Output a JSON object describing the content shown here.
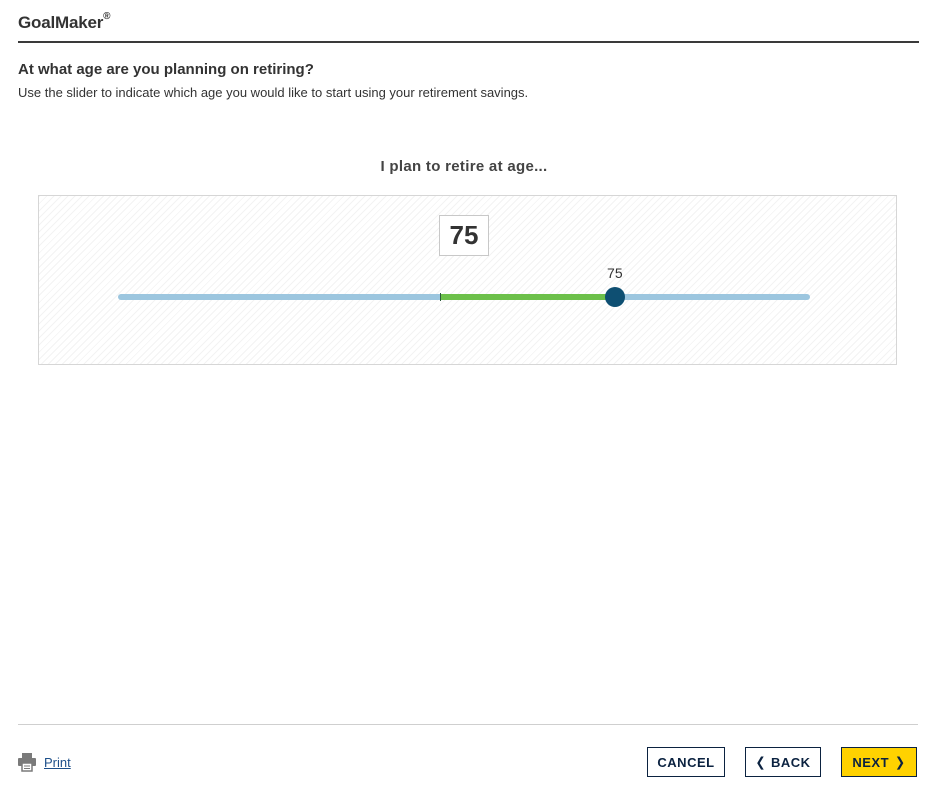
{
  "header": {
    "brand": "GoalMaker",
    "brand_mark": "®"
  },
  "question": {
    "title": "At what age are you planning on retiring?",
    "instruction": "Use the slider to indicate which age you would like to start using your retirement savings."
  },
  "slider": {
    "caption": "I plan to retire at age...",
    "value_box": "75",
    "thumb_label": "75",
    "value": 75,
    "fill_start_fraction": 0.465,
    "thumb_fraction": 0.718,
    "colors": {
      "track": "#9cc6df",
      "fill": "#6cc04a",
      "thumb": "#0e4f72"
    }
  },
  "footer": {
    "print_label": "Print",
    "print_icon": "printer-icon",
    "cancel_label": "CANCEL",
    "back_label": "BACK",
    "back_icon": "chevron-left-icon",
    "next_label": "NEXT",
    "next_icon": "chevron-right-icon",
    "colors": {
      "next_bg": "#ffd200",
      "button_text": "#0b2240"
    }
  }
}
